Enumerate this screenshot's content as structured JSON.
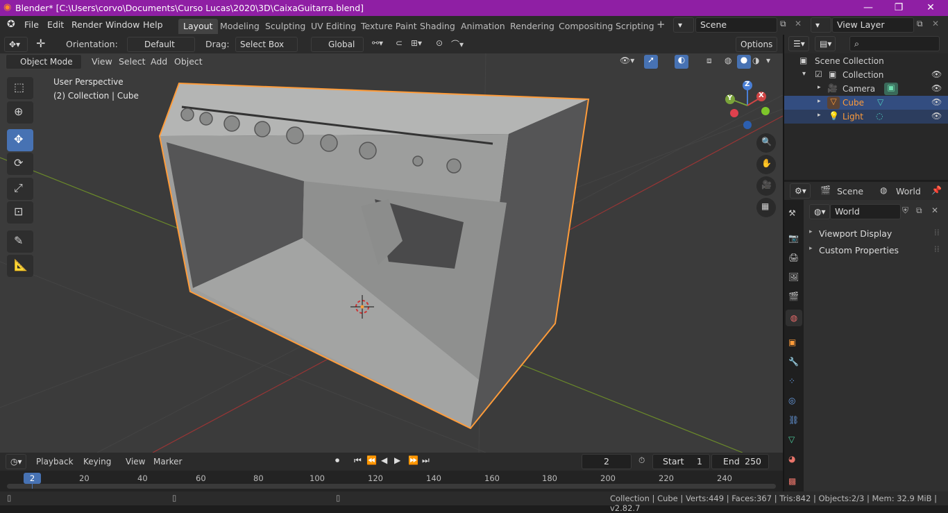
{
  "title_bar": {
    "title": "Blender* [C:\\Users\\corvo\\Documents\\Curso Lucas\\2020\\3D\\CaixaGuitarra.blend]",
    "minimize": "—",
    "restore": "❐",
    "close": "✕"
  },
  "menu": {
    "file": "File",
    "edit": "Edit",
    "render": "Render",
    "window": "Window",
    "help": "Help"
  },
  "workspaces": [
    "Layout",
    "Modeling",
    "Sculpting",
    "UV Editing",
    "Texture Paint",
    "Shading",
    "Animation",
    "Rendering",
    "Compositing",
    "Scripting"
  ],
  "scene_name": "Scene",
  "view_layer": "View Layer",
  "toolbar": {
    "orientation_label": "Orientation:",
    "orientation_value": "Default",
    "drag_label": "Drag:",
    "drag_value": "Select Box",
    "transform_space": "Global",
    "options": "Options"
  },
  "viewport_header": {
    "mode": "Object Mode",
    "view": "View",
    "select": "Select",
    "add": "Add",
    "object": "Object"
  },
  "viewport_overlay": {
    "perspective": "User Perspective",
    "collection_info": "(2) Collection | Cube"
  },
  "gizmo": {
    "x": "X",
    "y": "Y",
    "z": "Z"
  },
  "outliner": {
    "root": "Scene Collection",
    "collection": "Collection",
    "items": [
      {
        "name": "Camera",
        "color": "#d7d7d7"
      },
      {
        "name": "Cube",
        "color": "#ff9c3a"
      },
      {
        "name": "Light",
        "color": "#ff9c3a"
      }
    ]
  },
  "properties": {
    "tab_scene": "Scene",
    "tab_world": "World",
    "world_name": "World",
    "panels": [
      "Viewport Display",
      "Custom Properties"
    ]
  },
  "timeline": {
    "playback": "Playback",
    "keying": "Keying",
    "view": "View",
    "marker": "Marker",
    "current_frame": "2",
    "start_label": "Start",
    "start_value": "1",
    "end_label": "End",
    "end_value": "250",
    "ruler": [
      "2",
      "20",
      "40",
      "60",
      "80",
      "100",
      "120",
      "140",
      "160",
      "180",
      "200",
      "220",
      "240"
    ]
  },
  "status_bar": "Collection | Cube | Verts:449 | Faces:367 | Tris:842 | Objects:2/3 | Mem: 32.9 MiB | v2.82.7",
  "colors": {
    "title_bar": "#8f1fa4",
    "selection": "#ff9c3a",
    "active_tool": "#4772b3",
    "outliner_selected": "#334d80"
  }
}
